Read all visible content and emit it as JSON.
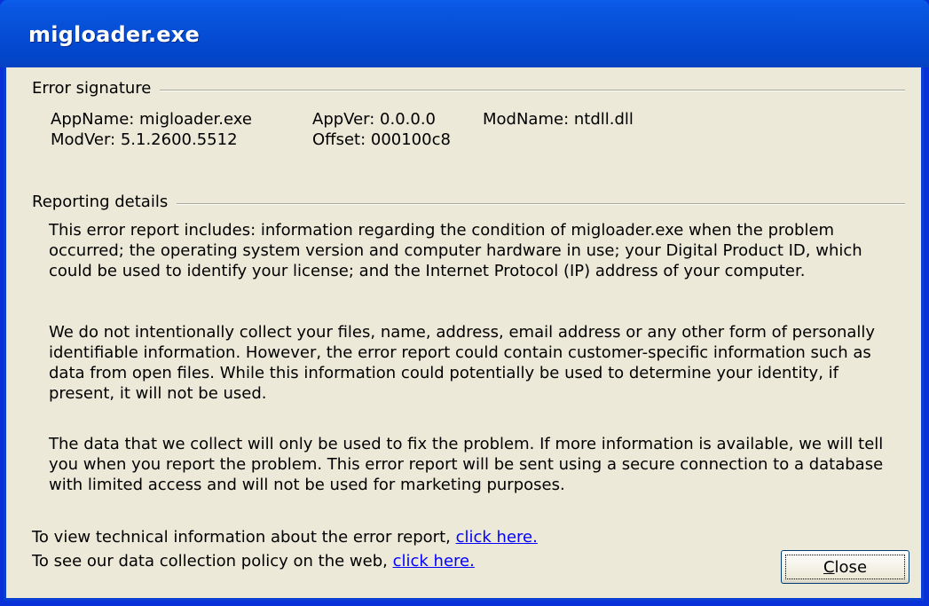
{
  "window": {
    "title": "migloader.exe"
  },
  "error_signature": {
    "heading": "Error signature",
    "app_name": "AppName: migloader.exe",
    "app_ver": "AppVer: 0.0.0.0",
    "mod_name": "ModName: ntdll.dll",
    "mod_ver": "ModVer: 5.1.2600.5512",
    "offset": "Offset: 000100c8"
  },
  "reporting": {
    "heading": "Reporting details",
    "p1": [
      "This error report includes: information regarding the condition of migloader.exe when the problem",
      "occurred; the operating system version and computer hardware in use; your Digital Product ID, which",
      "could be used to identify your license; and the Internet Protocol (IP) address of your computer."
    ],
    "p2": [
      "We do not intentionally collect your files, name, address, email address or any other form of personally",
      "identifiable information. However, the error report could contain customer-specific information such as",
      "data from open files. While this information could potentially be used to determine your identity, if",
      "present, it will not be used."
    ],
    "p3": [
      "The data that we collect will only be used to fix the problem. If more information is available, we will tell",
      "you when you report the problem. This error report will be sent using a secure connection to a database",
      "with limited access and will not be used for marketing purposes."
    ]
  },
  "footer": {
    "tech_text": "To view technical information about the error report,",
    "tech_link": "click here.",
    "policy_text": "To see our data collection policy on the web,",
    "policy_link": "click here."
  },
  "buttons": {
    "close": "Close"
  }
}
